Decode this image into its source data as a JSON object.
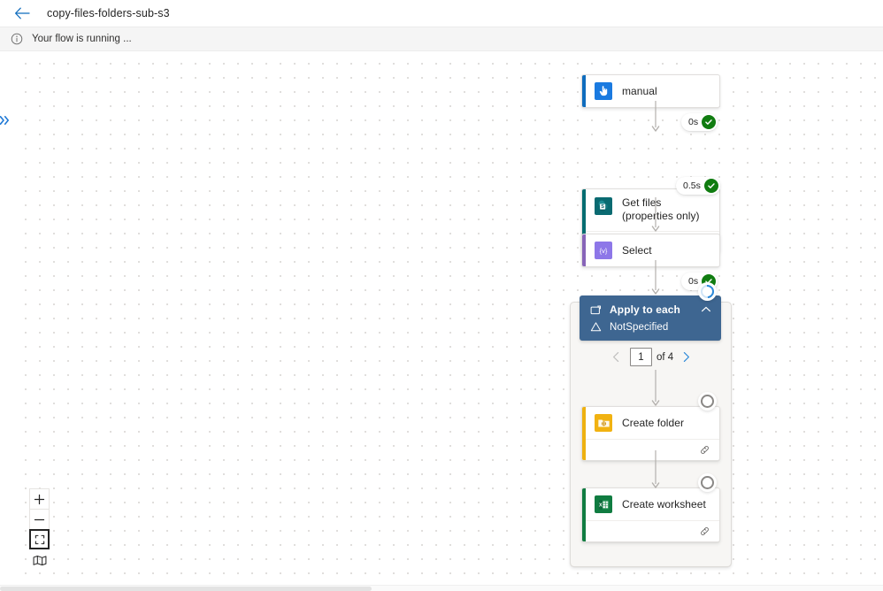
{
  "topbar": {
    "back_icon": "arrow-left-icon",
    "title": "copy-files-folders-sub-s3"
  },
  "messagebar": {
    "icon": "info-icon",
    "text": "Your flow is running ..."
  },
  "sidebar": {
    "expander_icon": "chevron-double-right-icon"
  },
  "flow": {
    "nodes": [
      {
        "id": "manual",
        "title": "manual",
        "icon": "manual-trigger-icon",
        "accent": "#0f6cbd",
        "icon_bg": "#0f6cbd",
        "status": "succeeded",
        "duration": "0s",
        "has_footer": false
      },
      {
        "id": "get-files",
        "title": "Get files (properties only)",
        "icon": "sharepoint-icon",
        "accent": "#036c70",
        "icon_bg": "#036c70",
        "status": "succeeded",
        "duration": "0.5s",
        "has_footer": true,
        "footer_icon": "link-icon"
      },
      {
        "id": "select",
        "title": "Select",
        "icon": "select-variable-icon",
        "accent": "#8764b8",
        "icon_bg": "#8764b8",
        "status": "succeeded",
        "duration": "0s",
        "has_footer": false
      }
    ],
    "scope": {
      "id": "apply-to-each",
      "title": "Apply to each",
      "subtitle": "NotSpecified",
      "foreach_icon": "foreach-icon",
      "warning_icon": "warning-triangle-icon",
      "collapse_icon": "chevron-up-icon",
      "status": "running",
      "header_color": "#3e6691",
      "pager": {
        "prev_icon": "chevron-left-icon",
        "prev_enabled": false,
        "value": "1",
        "of_label": "of 4",
        "next_icon": "chevron-right-icon",
        "next_enabled": true
      },
      "children": [
        {
          "id": "create-folder",
          "title": "Create folder",
          "icon": "sftp-folder-icon",
          "accent": "#eeb111",
          "icon_bg": "#eeb111",
          "status": "pending",
          "has_footer": true,
          "footer_icon": "link-icon"
        },
        {
          "id": "create-worksheet",
          "title": "Create worksheet",
          "icon": "excel-icon",
          "accent": "#107c41",
          "icon_bg": "#107c41",
          "status": "pending",
          "has_footer": true,
          "footer_icon": "link-icon"
        }
      ]
    }
  },
  "zoom_controls": {
    "zoom_in_label": "+",
    "zoom_out_label": "−",
    "fit_icon": "fit-to-screen-icon",
    "map_icon": "minimap-icon"
  }
}
